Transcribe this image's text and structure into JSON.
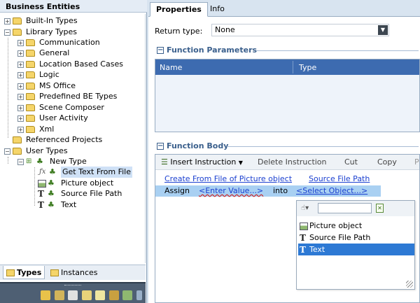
{
  "left_panel": {
    "header": "Business Entities",
    "tree": {
      "built_in_types": "Built-In Types",
      "library_types": "Library Types",
      "library_children": [
        "Communication",
        "General",
        "Location Based Cases",
        "Logic",
        "MS Office",
        "Predefined BE Types",
        "Scene Composer",
        "User Activity",
        "Xml"
      ],
      "referenced_projects": "Referenced Projects",
      "user_types": "User Types",
      "new_type": "New Type",
      "new_type_children": [
        "Get Text From File",
        "Picture object",
        "Source File Path",
        "Text"
      ]
    },
    "bottom_tabs": {
      "types": "Types",
      "instances": "Instances"
    }
  },
  "right_panel": {
    "tabs": [
      "Properties",
      "Info"
    ],
    "return_type_label": "Return type:",
    "return_type_value": "None",
    "function_parameters": {
      "title": "Function Parameters",
      "columns": [
        "Name",
        "Type"
      ]
    },
    "function_body": {
      "title": "Function Body",
      "toolbar": {
        "insert_instruction": "Insert Instruction",
        "delete_instruction": "Delete Instruction",
        "cut": "Cut",
        "copy": "Copy",
        "paste_fragment": "P"
      },
      "line1_link1": "Create From File of Picture object",
      "line1_link2": "Source File Path",
      "assign": {
        "assign": "Assign",
        "enter_value": "<Enter Value...>",
        "into": "into",
        "select_object": "<Select Object...>"
      },
      "popup": {
        "items": [
          "Picture object",
          "Source File Path",
          "Text"
        ],
        "selected_index": 2
      }
    }
  },
  "colors": {
    "accent_blue": "#3d6bb0",
    "selection_blue": "#2d79d4",
    "assign_row_bg": "#a9d0f2",
    "link_blue": "#1a3fd0"
  }
}
